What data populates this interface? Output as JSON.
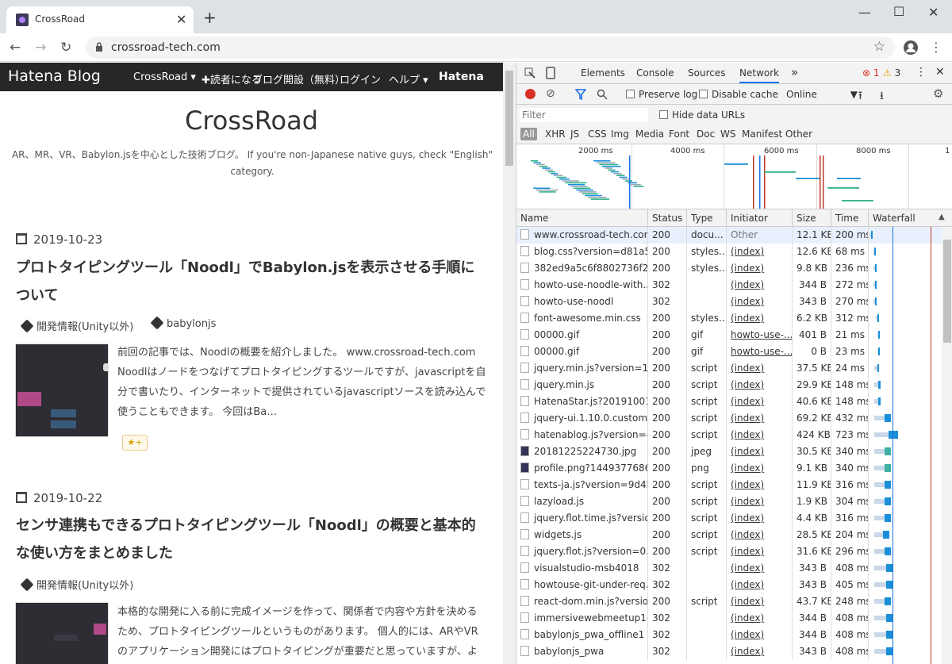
{
  "browser": {
    "tab_title": "CrossRoad",
    "url": "crossroad-tech.com"
  },
  "hatena_bar": {
    "logo": "Hatena Blog",
    "items": [
      "CrossRoad ▾",
      "✚読者になる",
      "ブログ開設（無料）",
      "ログイン",
      "ヘルプ ▾",
      "Hatena"
    ]
  },
  "blog": {
    "title": "CrossRoad",
    "description": "AR、MR、VR、Babylon.jsを中心とした技術ブログ。 If you're non-Japanese native guys, check \"English\" category."
  },
  "posts": [
    {
      "date": "2019-10-23",
      "title": "プロトタイピングツール「Noodl」でBabylon.jsを表示させる手順について",
      "tags": [
        "開発情報(Unity以外)",
        "babylonjs"
      ],
      "excerpt": "前回の記事では、Noodlの概要を紹介しました。 www.crossroad-tech.com Noodlはノードをつなげてプロトタイピングするツールですが、javascriptを自分で書いたり、インターネットで提供されているjavascriptソースを読み込んで使うこともできます。 今回はBa…",
      "star": "★+"
    },
    {
      "date": "2019-10-22",
      "title": "センサ連携もできるプロトタイピングツール「Noodl」の概要と基本的な使い方をまとめました",
      "tags": [
        "開発情報(Unity以外)"
      ],
      "excerpt": "本格的な開発に入る前に完成イメージを作って、関係者で内容や方針を決めるため、プロトタイピングツールというものがあります。 個人的には、ARやVRのアプリケーション開発にはプロトタイピングが重要だと思っていますが、よい手段"
    }
  ],
  "devtools": {
    "tabs": [
      "Elements",
      "Console",
      "Sources",
      "Network"
    ],
    "more": "»",
    "errors": "1",
    "warnings": "3",
    "toolbar": {
      "preserve_log": "Preserve log",
      "disable_cache": "Disable cache",
      "throttle": "Online"
    },
    "filter_placeholder": "Filter",
    "hide_data_urls": "Hide data URLs",
    "type_filters": [
      "All",
      "XHR",
      "JS",
      "CSS",
      "Img",
      "Media",
      "Font",
      "Doc",
      "WS",
      "Manifest",
      "Other"
    ],
    "timeline_ticks": [
      "2000 ms",
      "4000 ms",
      "6000 ms",
      "8000 ms",
      "1"
    ],
    "columns": [
      "Name",
      "Status",
      "Type",
      "Initiator",
      "Size",
      "Time",
      "Waterfall"
    ],
    "rows": [
      {
        "name": "www.crossroad-tech.com",
        "status": "200",
        "type": "docu...",
        "initiator": "Other",
        "size": "12.1 KB",
        "time": "200 ms",
        "wf": 0.02,
        "ww": 0.02,
        "icon": "doc"
      },
      {
        "name": "blog.css?version=d81a5...",
        "status": "200",
        "type": "styles...",
        "initiator": "(index)",
        "size": "12.6 KB",
        "time": "68 ms",
        "wf": 0.06,
        "ww": 0.02,
        "icon": "doc"
      },
      {
        "name": "382ed9a5c6f8802736f2e...",
        "status": "200",
        "type": "styles...",
        "initiator": "(index)",
        "size": "9.8 KB",
        "time": "236 ms",
        "wf": 0.06,
        "ww": 0.04,
        "icon": "doc"
      },
      {
        "name": "howto-use-noodle-with...",
        "status": "302",
        "type": "",
        "initiator": "(index)",
        "size": "344 B",
        "time": "272 ms",
        "wf": 0.06,
        "ww": 0.04,
        "icon": "doc"
      },
      {
        "name": "howto-use-noodl",
        "status": "302",
        "type": "",
        "initiator": "(index)",
        "size": "343 B",
        "time": "270 ms",
        "wf": 0.06,
        "ww": 0.04,
        "icon": "doc"
      },
      {
        "name": "font-awesome.min.css",
        "status": "200",
        "type": "styles...",
        "initiator": "(index)",
        "size": "6.2 KB",
        "time": "312 ms",
        "wf": 0.1,
        "ww": 0.03,
        "icon": "doc"
      },
      {
        "name": "00000.gif",
        "status": "200",
        "type": "gif",
        "initiator": "howto-use-...",
        "size": "401 B",
        "time": "21 ms",
        "wf": 0.12,
        "ww": 0.02,
        "icon": "doc"
      },
      {
        "name": "00000.gif",
        "status": "200",
        "type": "gif",
        "initiator": "howto-use-...",
        "size": "0 B",
        "time": "23 ms",
        "wf": 0.12,
        "ww": 0.02,
        "icon": "doc"
      },
      {
        "name": "jquery.min.js?version=1....",
        "status": "200",
        "type": "script",
        "initiator": "(index)",
        "size": "37.5 KB",
        "time": "24 ms",
        "wf": 0.08,
        "ww": 0.06,
        "icon": "doc"
      },
      {
        "name": "jquery.min.js",
        "status": "200",
        "type": "script",
        "initiator": "(index)",
        "size": "29.9 KB",
        "time": "148 ms",
        "wf": 0.08,
        "ww": 0.08,
        "icon": "doc"
      },
      {
        "name": "HatenaStar.js?20191001",
        "status": "200",
        "type": "script",
        "initiator": "(index)",
        "size": "40.6 KB",
        "time": "148 ms",
        "wf": 0.08,
        "ww": 0.08,
        "icon": "doc"
      },
      {
        "name": "jquery-ui.1.10.0.custom....",
        "status": "200",
        "type": "script",
        "initiator": "(index)",
        "size": "69.2 KB",
        "time": "432 ms",
        "wf": 0.08,
        "ww": 0.22,
        "icon": "doc"
      },
      {
        "name": "hatenablog.js?version=4...",
        "status": "200",
        "type": "script",
        "initiator": "(index)",
        "size": "424 KB",
        "time": "723 ms",
        "wf": 0.08,
        "ww": 0.32,
        "icon": "doc"
      },
      {
        "name": "20181225224730.jpg",
        "status": "200",
        "type": "jpeg",
        "initiator": "(index)",
        "size": "30.5 KB",
        "time": "340 ms",
        "wf": 0.08,
        "ww": 0.22,
        "icon": "jpg"
      },
      {
        "name": "profile.png?1449377686",
        "status": "200",
        "type": "png",
        "initiator": "(index)",
        "size": "9.1 KB",
        "time": "340 ms",
        "wf": 0.08,
        "ww": 0.22,
        "icon": "png"
      },
      {
        "name": "texts-ja.js?version=9d4b...",
        "status": "200",
        "type": "script",
        "initiator": "(index)",
        "size": "11.9 KB",
        "time": "316 ms",
        "wf": 0.08,
        "ww": 0.22,
        "icon": "doc"
      },
      {
        "name": "lazyload.js",
        "status": "200",
        "type": "script",
        "initiator": "(index)",
        "size": "1.9 KB",
        "time": "304 ms",
        "wf": 0.08,
        "ww": 0.22,
        "icon": "doc"
      },
      {
        "name": "jquery.flot.time.js?versio...",
        "status": "200",
        "type": "script",
        "initiator": "(index)",
        "size": "4.4 KB",
        "time": "316 ms",
        "wf": 0.08,
        "ww": 0.22,
        "icon": "doc"
      },
      {
        "name": "widgets.js",
        "status": "200",
        "type": "script",
        "initiator": "(index)",
        "size": "28.5 KB",
        "time": "204 ms",
        "wf": 0.08,
        "ww": 0.2,
        "icon": "doc"
      },
      {
        "name": "jquery.flot.js?version=0....",
        "status": "200",
        "type": "script",
        "initiator": "(index)",
        "size": "31.6 KB",
        "time": "296 ms",
        "wf": 0.08,
        "ww": 0.22,
        "icon": "doc"
      },
      {
        "name": "visualstudio-msb4018",
        "status": "302",
        "type": "",
        "initiator": "(index)",
        "size": "343 B",
        "time": "408 ms",
        "wf": 0.08,
        "ww": 0.26,
        "icon": "doc"
      },
      {
        "name": "howtouse-git-under-req...",
        "status": "302",
        "type": "",
        "initiator": "(index)",
        "size": "343 B",
        "time": "405 ms",
        "wf": 0.08,
        "ww": 0.26,
        "icon": "doc"
      },
      {
        "name": "react-dom.min.js?versio...",
        "status": "200",
        "type": "script",
        "initiator": "(index)",
        "size": "43.7 KB",
        "time": "248 ms",
        "wf": 0.08,
        "ww": 0.22,
        "icon": "doc"
      },
      {
        "name": "immersivewebmeetup1-...",
        "status": "302",
        "type": "",
        "initiator": "(index)",
        "size": "344 B",
        "time": "408 ms",
        "wf": 0.08,
        "ww": 0.26,
        "icon": "doc"
      },
      {
        "name": "babylonjs_pwa_offline1",
        "status": "302",
        "type": "",
        "initiator": "(index)",
        "size": "344 B",
        "time": "408 ms",
        "wf": 0.08,
        "ww": 0.26,
        "icon": "doc"
      },
      {
        "name": "babylonjs_pwa",
        "status": "302",
        "type": "",
        "initiator": "(index)",
        "size": "343 B",
        "time": "408 ms",
        "wf": 0.08,
        "ww": 0.26,
        "icon": "doc"
      }
    ]
  }
}
